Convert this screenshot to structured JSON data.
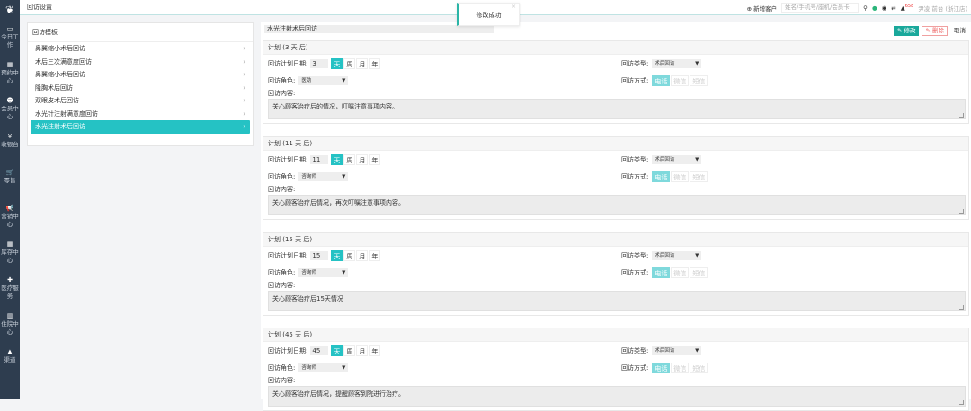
{
  "sidebar": {
    "items": [
      {
        "icon": "laptop-icon",
        "glyph": "▭",
        "label": "今日工作"
      },
      {
        "icon": "calendar-icon",
        "glyph": "▦",
        "label": "预约中心"
      },
      {
        "icon": "users-icon",
        "glyph": "☻",
        "label": "会员中心"
      },
      {
        "icon": "yen-icon",
        "glyph": "¥",
        "label": "收银台"
      },
      {
        "icon": "cart-icon",
        "glyph": "🛒",
        "label": "零售"
      },
      {
        "icon": "bullhorn-icon",
        "glyph": "📢",
        "label": "营销中心"
      },
      {
        "icon": "grid-icon",
        "glyph": "▦",
        "label": "库存中心"
      },
      {
        "icon": "medkit-icon",
        "glyph": "✚",
        "label": "医疗服务"
      },
      {
        "icon": "building-icon",
        "glyph": "▥",
        "label": "住院中心"
      },
      {
        "icon": "sitemap-icon",
        "glyph": "▲",
        "label": "渠道"
      }
    ]
  },
  "header": {
    "title": "回访设置",
    "new_customer": "新增客户",
    "search_placeholder": "姓名/手机号/座机/会员卡",
    "badge": "658",
    "user": "尹凌 前台 (浙江店)"
  },
  "toast": "修改成功",
  "templates": {
    "title": "回访模板",
    "items": [
      "鼻翼缩小术后回访",
      "术后三次满意度回访",
      "鼻翼缩小术后回访",
      "隆胸术后回访",
      "双眼皮术后回访",
      "水光针注射满意度回访",
      "水光注射术后回访"
    ],
    "active": 6
  },
  "detail": {
    "name": "水光注射术后回访",
    "edit": "修改",
    "delete": "删除",
    "cancel": "取消",
    "labels": {
      "date": "回访计划日期:",
      "type": "回访类型:",
      "role": "回访角色:",
      "method": "回访方式:",
      "content": "回访内容:"
    },
    "units": [
      "天",
      "周",
      "月",
      "年"
    ],
    "methods": [
      "电话",
      "微信",
      "短信"
    ],
    "plans": [
      {
        "header": "计划 (3 天 后)",
        "num": "3",
        "type": "术后回访",
        "role": "医助",
        "content": "关心顾客治疗后的情况，叮嘱注意事项内容。"
      },
      {
        "header": "计划 (11 天 后)",
        "num": "11",
        "type": "术后回访",
        "role": "咨询师",
        "content": "关心顾客治疗后情况，再次叮嘱注意事项内容。"
      },
      {
        "header": "计划 (15 天 后)",
        "num": "15",
        "type": "术后回访",
        "role": "咨询师",
        "content": "关心顾客治疗后15天情况"
      },
      {
        "header": "计划 (45 天 后)",
        "num": "45",
        "type": "术后回访",
        "role": "咨询师",
        "content": "关心顾客治疗后情况，提醒顾客到院进行治疗。"
      }
    ]
  },
  "colors": {
    "accent": "#25c2c4",
    "sidebar": "#2e3d4f",
    "danger": "#e66666"
  }
}
